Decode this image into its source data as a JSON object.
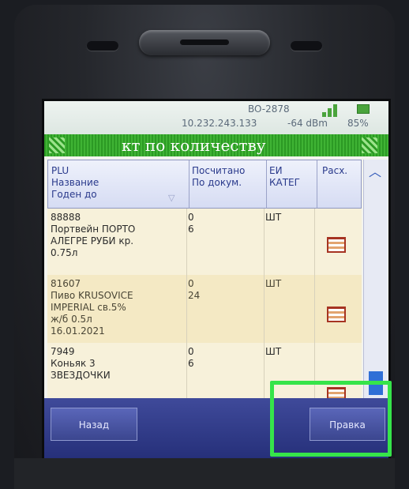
{
  "status": {
    "device_id": "BO-2878",
    "ip": "10.232.243.133",
    "signal": "-64 dBm",
    "battery": "85%"
  },
  "title": "кт по количеству",
  "columns": {
    "col1_line1": "PLU",
    "col1_line2": "Название",
    "col1_line3": "Годен до",
    "col2_line1": "Посчитано",
    "col2_line2": "По докум.",
    "col3_line1": "ЕИ",
    "col3_line2": "КАТЕГ",
    "col4": "Расх."
  },
  "rows": [
    {
      "plu": "88888",
      "name_lines": [
        "Портвейн ПОРТО",
        "АЛЕГРЕ РУБИ кр.",
        "0.75л"
      ],
      "date": "",
      "counted": "0",
      "by_doc": "6",
      "unit": "ШТ"
    },
    {
      "plu": "81607",
      "name_lines": [
        "Пиво KRUSOVICE",
        "IMPERIAL св.5%",
        "ж/б 0.5л"
      ],
      "date": "16.01.2021",
      "counted": "0",
      "by_doc": "24",
      "unit": "ШТ"
    },
    {
      "plu": "7949",
      "name_lines": [
        "Коньяк 3",
        "ЗВЕЗДОЧКИ",
        ""
      ],
      "date": "",
      "counted": "0",
      "by_doc": "6",
      "unit": "ШТ"
    }
  ],
  "buttons": {
    "back": "Назад",
    "edit": "Правка"
  },
  "colors": {
    "title_bar": "#3fb334",
    "bottom_bar": "#26307a",
    "highlight": "#36e44a"
  }
}
